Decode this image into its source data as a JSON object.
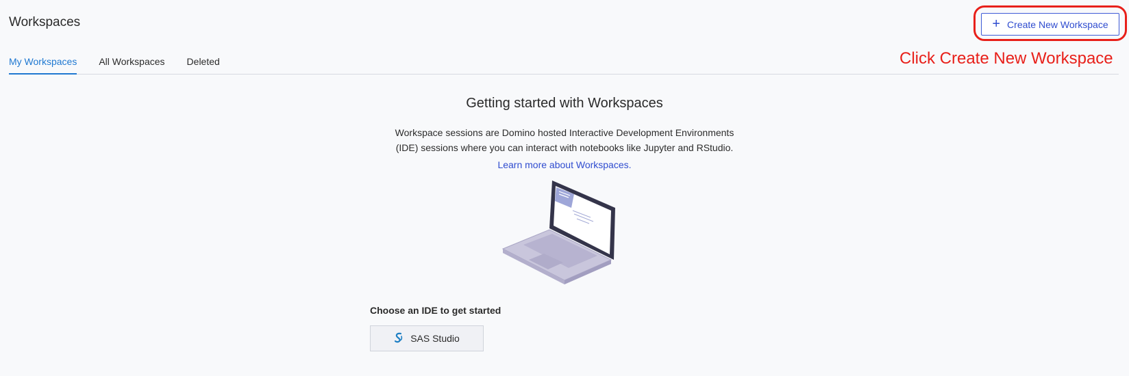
{
  "header": {
    "title": "Workspaces",
    "create_button_label": "Create New Workspace"
  },
  "annotation": {
    "text": "Click Create New Workspace",
    "color": "#e8201a"
  },
  "tabs": [
    {
      "label": "My Workspaces",
      "active": true
    },
    {
      "label": "All Workspaces",
      "active": false
    },
    {
      "label": "Deleted",
      "active": false
    }
  ],
  "empty_state": {
    "heading": "Getting started with Workspaces",
    "description": "Workspace sessions are Domino hosted Interactive Development Environments (IDE) sessions where you can interact with notebooks like Jupyter and RStudio.",
    "link": "Learn more about Workspaces.",
    "illustration": "laptop-illustration"
  },
  "ide": {
    "prompt": "Choose an IDE to get started",
    "options": [
      {
        "label": "SAS Studio",
        "icon": "sas-logo-icon"
      }
    ]
  },
  "colors": {
    "accent": "#2f4ccf",
    "tab_active": "#1f78d1",
    "background": "#f8f9fb"
  }
}
